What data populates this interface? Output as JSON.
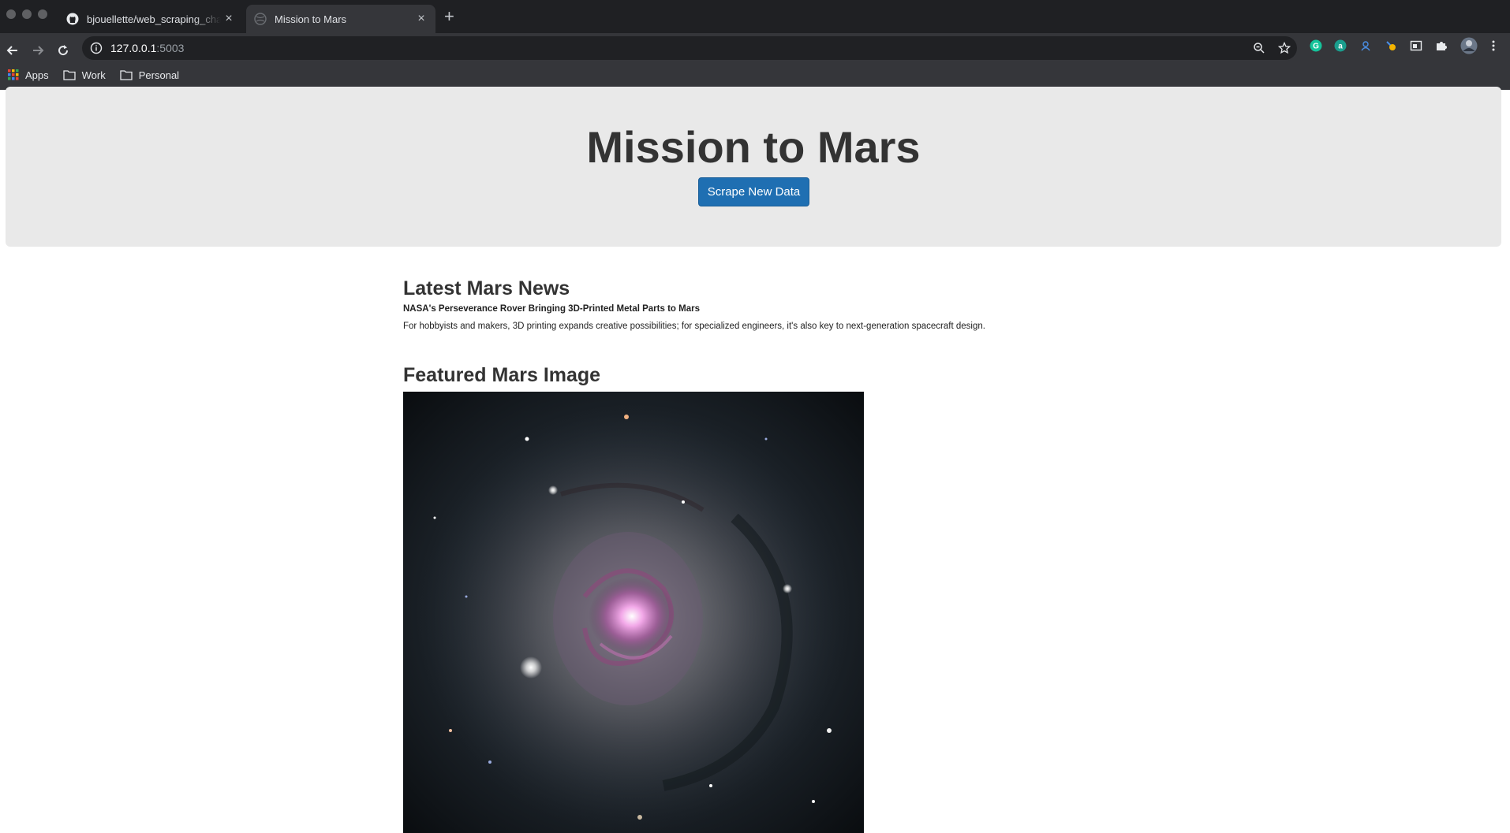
{
  "browser": {
    "tabs": [
      {
        "title": "bjouellette/web_scraping_challenge",
        "active": false,
        "icon": "github-icon"
      },
      {
        "title": "Mission to Mars",
        "active": true,
        "icon": "globe-icon"
      }
    ],
    "close_glyph": "×",
    "new_tab_glyph": "+",
    "url_host": "127.0.0.1",
    "url_port": ":5003",
    "bookmarks": [
      "Apps",
      "Work",
      "Personal"
    ],
    "extension_icons": [
      "grammarly-icon",
      "amazon-assistant-icon",
      "ext-icon",
      "ext-icon",
      "tab-icon",
      "puzzle-icon",
      "profile-avatar-icon",
      "more-icon"
    ]
  },
  "page": {
    "title": "Mission to Mars",
    "scrape_button": "Scrape New Data",
    "news": {
      "heading": "Latest Mars News",
      "title": "NASA's Perseverance Rover Bringing 3D-Printed Metal Parts to Mars",
      "paragraph": "For hobbyists and makers, 3D printing expands creative possibilities; for specialized engineers, it's also key to next-generation spacecraft design."
    },
    "featured": {
      "heading": "Featured Mars Image"
    }
  },
  "colors": {
    "accent": "#1f6fb2",
    "jumbotron": "#e9e9e9",
    "chrome_dark": "#1f2023",
    "chrome_toolbar": "#35363a"
  }
}
